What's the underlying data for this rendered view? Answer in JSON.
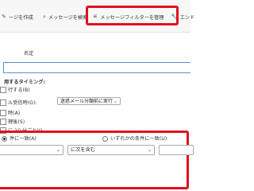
{
  "toolbar": {
    "create_label": "ージを作成",
    "search_label": "メッセージを検索",
    "filter_label": "メッセージフィルターを管理",
    "end_label": "エンド",
    "create_icon": "pencil-icon",
    "search_icon": "search-icon",
    "filter_icon": "filter-icon",
    "end_icon": "wrench-icon"
  },
  "form": {
    "name_label": "名定",
    "timing_heading": "用するタイミング:",
    "options": [
      "行する(B)",
      "ル受信時(G):",
      "時(A)",
      "理後(S)",
      "に 10 分ごと(I)"
    ],
    "timing_select": "迷惑メール分類前に実行"
  },
  "rules": {
    "match_all_label": "件に一致(A)",
    "match_any_label": "いずれかの条件に一致(U)",
    "operator": "に次を含む"
  },
  "colors": {
    "highlight": "#e01020",
    "input_border": "#5b8fd8"
  }
}
